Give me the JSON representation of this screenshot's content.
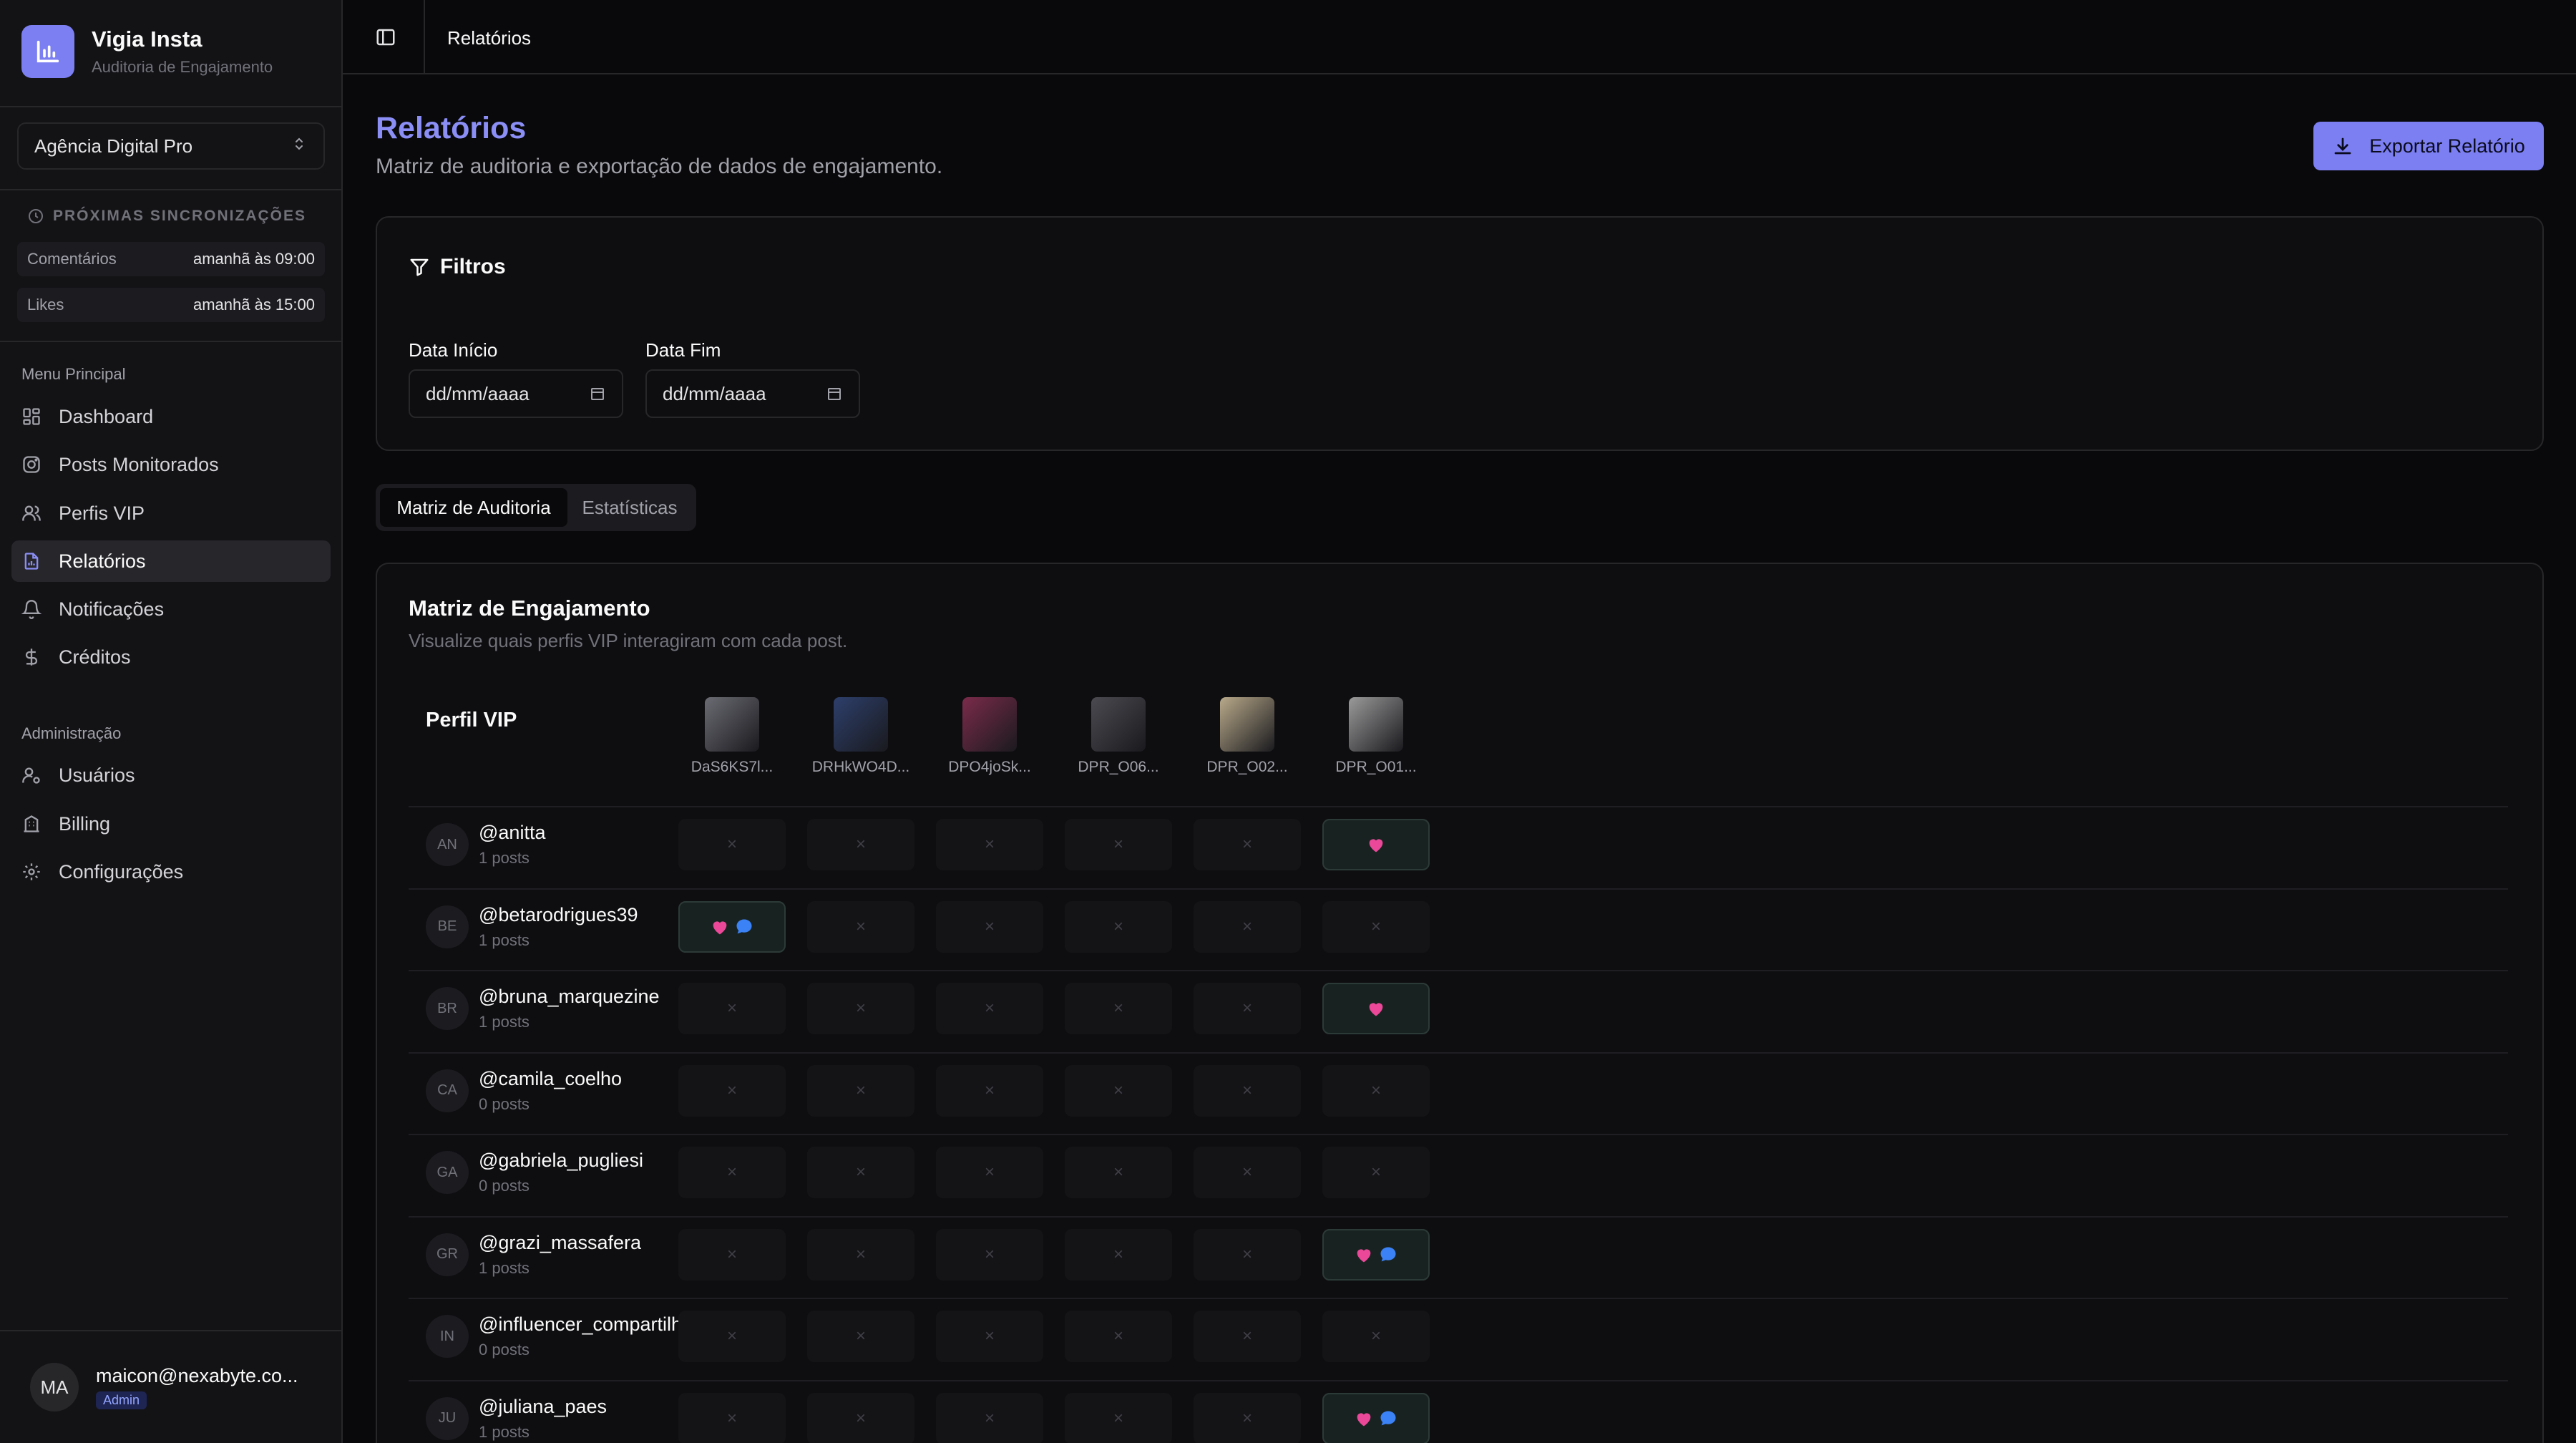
{
  "brand": {
    "title": "Vigia Insta",
    "subtitle": "Auditoria de Engajamento"
  },
  "org_select": {
    "value": "Agência Digital Pro"
  },
  "sync": {
    "title": "PRÓXIMAS SINCRONIZAÇÕES",
    "rows": [
      {
        "label": "Comentários",
        "value": "amanhã às 09:00"
      },
      {
        "label": "Likes",
        "value": "amanhã às 15:00"
      }
    ]
  },
  "nav": {
    "main_label": "Menu Principal",
    "items": [
      {
        "label": "Dashboard",
        "icon": "dashboard-icon"
      },
      {
        "label": "Posts Monitorados",
        "icon": "instagram-icon"
      },
      {
        "label": "Perfis VIP",
        "icon": "users-icon"
      },
      {
        "label": "Relatórios",
        "icon": "report-icon",
        "active": true
      },
      {
        "label": "Notificações",
        "icon": "bell-icon"
      },
      {
        "label": "Créditos",
        "icon": "dollar-icon"
      }
    ],
    "admin_label": "Administração",
    "admin_items": [
      {
        "label": "Usuários",
        "icon": "user-cog-icon"
      },
      {
        "label": "Billing",
        "icon": "building-icon"
      },
      {
        "label": "Configurações",
        "icon": "gear-icon"
      }
    ]
  },
  "user": {
    "initials": "MA",
    "email": "maicon@nexabyte.co...",
    "role": "Admin"
  },
  "topbar": {
    "breadcrumb": "Relatórios"
  },
  "header": {
    "title": "Relatórios",
    "subtitle": "Matriz de auditoria e exportação de dados de engajamento.",
    "export_label": "Exportar Relatório"
  },
  "filters": {
    "title": "Filtros",
    "start_label": "Data Início",
    "start_value": "dd/mm/aaaa",
    "end_label": "Data Fim",
    "end_value": "dd/mm/aaaa"
  },
  "tabs": [
    {
      "label": "Matriz de Auditoria",
      "active": true
    },
    {
      "label": "Estatísticas",
      "active": false
    }
  ],
  "matrix": {
    "title": "Matriz de Engajamento",
    "subtitle": "Visualize quais perfis VIP interagiram com cada post.",
    "profile_header": "Perfil VIP",
    "empty_mark": "×",
    "posts": [
      {
        "name": "DaS6KS7l...",
        "color": "#6b6b73"
      },
      {
        "name": "DRHkWO4D...",
        "color": "#2d3f6b"
      },
      {
        "name": "DPO4joSk...",
        "color": "#7a2b4a"
      },
      {
        "name": "DPR_O06...",
        "color": "#4a4a50"
      },
      {
        "name": "DPR_O02...",
        "color": "#b8a98a"
      },
      {
        "name": "DPR_O01...",
        "color": "#9a9a9a"
      }
    ],
    "colors": {
      "like": "#ec4899",
      "comment": "#3b82f6"
    },
    "rows": [
      {
        "initials": "AN",
        "handle": "@anitta",
        "posts": "1 posts",
        "cells": [
          "",
          "",
          "",
          "",
          "",
          "L"
        ]
      },
      {
        "initials": "BE",
        "handle": "@betarodrigues39",
        "posts": "1 posts",
        "cells": [
          "LC",
          "",
          "",
          "",
          "",
          ""
        ]
      },
      {
        "initials": "BR",
        "handle": "@bruna_marquezine",
        "posts": "1 posts",
        "cells": [
          "",
          "",
          "",
          "",
          "",
          "L"
        ]
      },
      {
        "initials": "CA",
        "handle": "@camila_coelho",
        "posts": "0 posts",
        "cells": [
          "",
          "",
          "",
          "",
          "",
          ""
        ]
      },
      {
        "initials": "GA",
        "handle": "@gabriela_pugliesi",
        "posts": "0 posts",
        "cells": [
          "",
          "",
          "",
          "",
          "",
          ""
        ]
      },
      {
        "initials": "GR",
        "handle": "@grazi_massafera",
        "posts": "1 posts",
        "cells": [
          "",
          "",
          "",
          "",
          "",
          "LC"
        ]
      },
      {
        "initials": "IN",
        "handle": "@influencer_compartilhado",
        "posts": "0 posts",
        "cells": [
          "",
          "",
          "",
          "",
          "",
          ""
        ]
      },
      {
        "initials": "JU",
        "handle": "@juliana_paes",
        "posts": "1 posts",
        "cells": [
          "",
          "",
          "",
          "",
          "",
          "LC"
        ]
      }
    ]
  }
}
